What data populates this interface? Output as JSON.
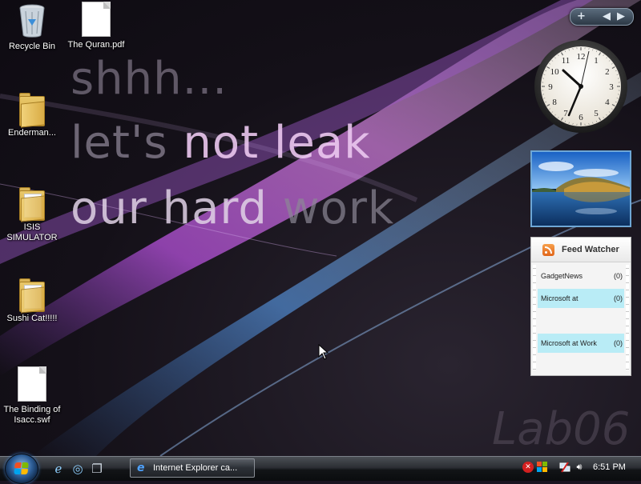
{
  "wallpaper": {
    "line1": "shhh...",
    "line2_a": "let's ",
    "line2_b": "not leak",
    "line3_a": "our hard ",
    "line3_b": "work",
    "brand": "Lab06"
  },
  "desktop_icons": [
    {
      "label": "Recycle Bin",
      "icon": "recycle-bin-icon"
    },
    {
      "label": "The Quran.pdf",
      "icon": "file-icon"
    },
    {
      "label": "Enderman...",
      "icon": "folder-icon"
    },
    {
      "label": "ISIS SIMULATOR",
      "icon": "folder-icon"
    },
    {
      "label": "Sushi Cat!!!!!",
      "icon": "folder-icon"
    },
    {
      "label": "The Binding of Isacc.swf",
      "icon": "file-icon"
    }
  ],
  "sidebar_control": {
    "add": "+",
    "prev": "◀",
    "next": "▶"
  },
  "clock": {
    "time": "6:51 PM",
    "numerals": [
      "12",
      "1",
      "2",
      "3",
      "4",
      "5",
      "6",
      "7",
      "8",
      "9",
      "10",
      "11"
    ]
  },
  "feed_watcher": {
    "title": "Feed Watcher",
    "items": [
      {
        "name": "GadgetNews",
        "count": "(0)",
        "highlight": false
      },
      {
        "name": "Microsoft at",
        "count": "(0)",
        "highlight": true
      },
      {
        "name": "Microsoft at Work",
        "count": "(0)",
        "highlight": true
      }
    ]
  },
  "taskbar": {
    "start_label": "Start",
    "quick_launch": [
      "internet-explorer-icon",
      "windows-update-icon",
      "switch-windows-icon"
    ],
    "active_task": "Internet Explorer ca...",
    "tray_icons": [
      "security-alert-icon",
      "windows-flag-icon",
      "network-icon",
      "volume-icon"
    ],
    "clock": "6:51 PM"
  },
  "colors": {
    "accent_purple": "#c96ad8",
    "accent_blue": "#6aa7e6",
    "feed_highlight": "#b9ecf6",
    "taskbar": "#1c1f23"
  }
}
